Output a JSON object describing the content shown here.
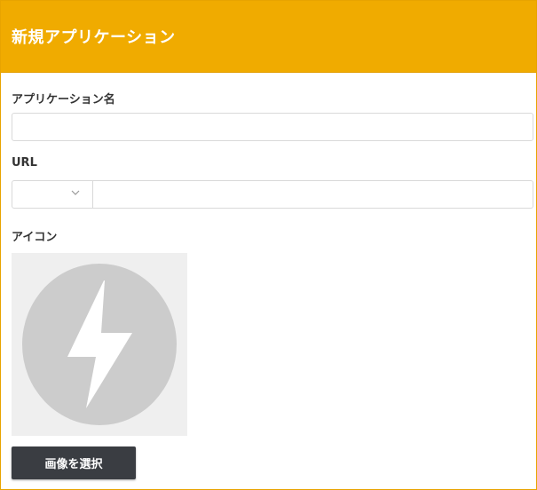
{
  "dialog": {
    "title": "新規アプリケーション"
  },
  "fields": {
    "app_name": {
      "label": "アプリケーション名",
      "value": "",
      "placeholder": ""
    },
    "url": {
      "label": "URL",
      "scheme_selected": "",
      "value": "",
      "placeholder": ""
    },
    "icon": {
      "label": "アイコン",
      "placeholder_icon": "lightning-bolt-icon",
      "select_button_label": "画像を選択"
    }
  },
  "colors": {
    "header": "#f0ab00",
    "button": "#3a3d42",
    "icon_bg": "#efefef",
    "icon_circle": "#cccccc"
  }
}
